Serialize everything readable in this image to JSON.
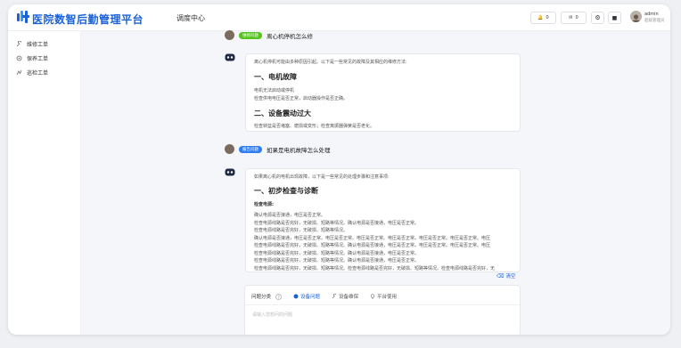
{
  "header": {
    "brand": "医院数智后勤管理平台",
    "title": "调度中心",
    "btn1_value": "0",
    "btn2_value": "0",
    "user_name": "admin",
    "user_role": "超级管理员"
  },
  "sidebar": {
    "items": [
      {
        "label": "维修工单",
        "icon": "wrench-icon"
      },
      {
        "label": "保养工单",
        "icon": "gear-icon"
      },
      {
        "label": "巡检工单",
        "icon": "route-icon"
      }
    ]
  },
  "chat": {
    "q1_tag": "维修问题",
    "q1_text": "离心机停机怎么修",
    "a1": {
      "intro": "离心机停机可能由多种原因引起。以下是一些常见的故障及其相应的维修方法:",
      "s1_title": "一、电机故障",
      "s1_lines": [
        "电机无法启动或停机",
        "检查供电电压是否正常，启动器操作是否正确。"
      ],
      "s2_title": "二、设备震动过大",
      "s2_lines": [
        "检查转篮是否堵塞、磨损或变形；检查离振器弹簧是否老化。"
      ]
    },
    "q2_tag": "报告问题",
    "q2_text": "如果是电机故障怎么处理",
    "a2": {
      "intro": "如果离心机的电机出现故障，以下是一些常见的处理步骤和注意事项:",
      "s1_title": "一、初步检查与诊断",
      "sub": "检查电源:",
      "lines": [
        "确认电源是否接通，电压是否正常。",
        "检查电源线路是否完好，无破损、短路等情况。确认电源是否接通，电压是否正常。",
        "检查电源线路是否完好，无破损、短路等情况。",
        "确认电源是否接通，电压是否正常。电压是否正常。电压是否正常。电压是否正常。电压是否正常。电压是否正常。电压",
        "检查电源线路是否完好，无破损、短路等情况。确认电源是否接通，电压是否正常。电压是否正常。电压是否正常。电压",
        "检查电源线路是否完好，无破损、短路等情况。确认电源是否接通，电压是否正常。",
        "检查电源线路是否完好，无破损、短路等情况。确认电源是否接通，电压是否正常。",
        "检查电源线路是否完好，无破损、短路等情况。检查电源线路是否完好，无破损、短路等情况。检查电源线路是否完好，无"
      ]
    },
    "clear_label": "清空"
  },
  "input": {
    "category_label": "问题分类",
    "options": [
      {
        "label": "设备问题",
        "icon": "pin-icon"
      },
      {
        "label": "设备维保",
        "icon": "wrench-icon"
      },
      {
        "label": "平台使用",
        "icon": "location-icon"
      }
    ],
    "placeholder": "请输入您想问的问题"
  },
  "colors": {
    "accent": "#1a61d6",
    "tag_green": "#52c41a",
    "tag_blue": "#2f7df6"
  }
}
